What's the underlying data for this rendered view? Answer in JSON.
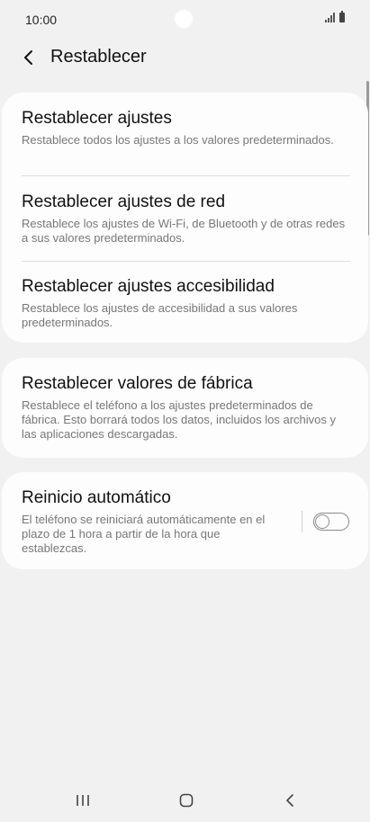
{
  "status_bar": {
    "time": "10:00"
  },
  "header": {
    "back_icon": "chevron-left-icon",
    "title": "Restablecer"
  },
  "groups": [
    {
      "items": [
        {
          "title": "Restablecer ajustes",
          "description": "Restablece todos los ajustes a los valores predeterminados."
        },
        {
          "title": "Restablecer ajustes de red",
          "description": "Restablece los ajustes de Wi-Fi, de Bluetooth y de otras redes a sus valores predeterminados."
        },
        {
          "title": "Restablecer ajustes accesibilidad",
          "description": "Restablece los ajustes de accesibilidad a sus valores predeterminados."
        }
      ]
    },
    {
      "items": [
        {
          "title": "Restablecer valores de fábrica",
          "description": "Restablece el teléfono a los ajustes predeterminados de fábrica. Esto borrará todos los datos, incluidos los archivos y las aplicaciones descargadas."
        }
      ]
    },
    {
      "items": [
        {
          "title": "Reinicio automático",
          "description": "El teléfono se reiniciará automáticamente en el plazo de 1 hora a partir de la hora que establezcas.",
          "toggle_on": false
        }
      ]
    }
  ],
  "nav_bar": {
    "icons": [
      "recents-icon",
      "home-icon",
      "back-icon"
    ]
  },
  "colors": {
    "background": "#f1f1f1",
    "card": "#fdfdfd",
    "description_text": "#777777",
    "toggle_outline": "#8a8a8a"
  }
}
